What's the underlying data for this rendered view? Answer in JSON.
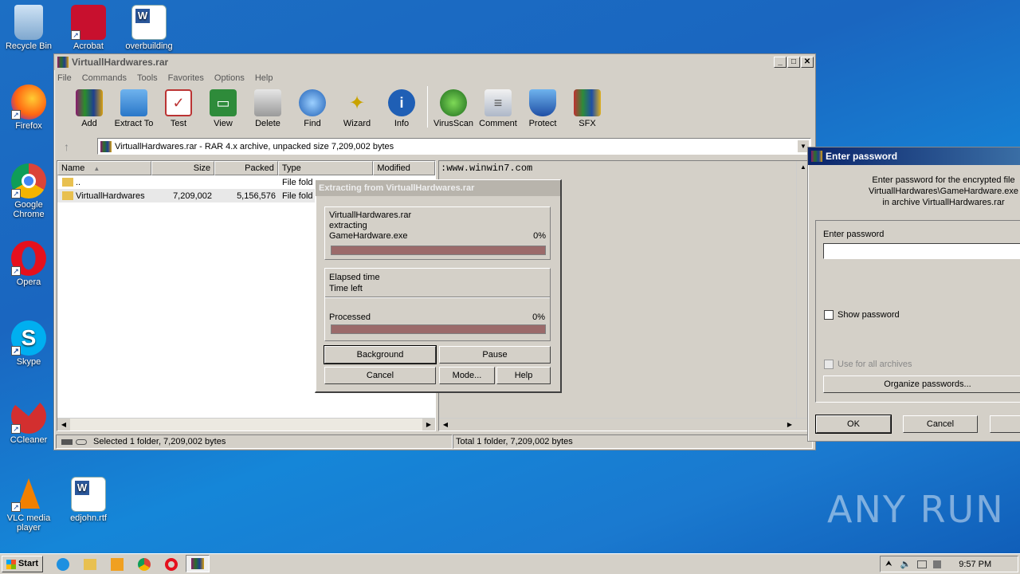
{
  "desktop": {
    "icons": [
      {
        "label": "Recycle Bin"
      },
      {
        "label": "Acrobat"
      },
      {
        "label": "overbuilding"
      },
      {
        "label": "Firefox"
      },
      {
        "label": "Google Chrome"
      },
      {
        "label": "Opera"
      },
      {
        "label": "Skype"
      },
      {
        "label": "CCleaner"
      },
      {
        "label": "VLC media player"
      },
      {
        "label": "edjohn.rtf"
      }
    ],
    "watermark": "ANY RUN"
  },
  "winrar": {
    "title": "VirtuallHardwares.rar",
    "menu": [
      "File",
      "Commands",
      "Tools",
      "Favorites",
      "Options",
      "Help"
    ],
    "toolbar": [
      "Add",
      "Extract To",
      "Test",
      "View",
      "Delete",
      "Find",
      "Wizard",
      "Info",
      "VirusScan",
      "Comment",
      "Protect",
      "SFX"
    ],
    "address": "VirtuallHardwares.rar - RAR 4.x archive, unpacked size 7,209,002 bytes",
    "columns": {
      "name": "Name",
      "size": "Size",
      "packed": "Packed",
      "type": "Type",
      "modified": "Modified"
    },
    "rows": [
      {
        "name": "..",
        "size": "",
        "packed": "",
        "type": "File fold"
      },
      {
        "name": "VirtuallHardwares",
        "size": "7,209,002",
        "packed": "5,156,576",
        "type": "File fold"
      }
    ],
    "comment": ":www.winwin7.com",
    "status_left": "Selected 1 folder, 7,209,002 bytes",
    "status_right": "Total 1 folder, 7,209,002 bytes"
  },
  "extract": {
    "title": "Extracting from VirtuallHardwares.rar",
    "archive": "VirtuallHardwares.rar",
    "action": "extracting",
    "file": "GameHardware.exe",
    "file_pct": "0%",
    "file_progress": 0,
    "elapsed_label": "Elapsed time",
    "left_label": "Time left",
    "processed_label": "Processed",
    "processed_pct": "0%",
    "processed_progress": 0,
    "buttons": {
      "background": "Background",
      "pause": "Pause",
      "cancel": "Cancel",
      "mode": "Mode...",
      "help": "Help"
    }
  },
  "password": {
    "title": "Enter password",
    "msg1": "Enter password for the encrypted file",
    "msg2": "VirtuallHardwares\\GameHardware.exe",
    "msg3": "in archive VirtuallHardwares.rar",
    "field_label": "Enter password",
    "value": "",
    "show_label": "Show password",
    "all_label": "Use for all archives",
    "organize": "Organize passwords...",
    "ok": "OK",
    "cancel": "Cancel"
  },
  "taskbar": {
    "start": "Start",
    "time": "9:57 PM"
  },
  "colors": {
    "titlebar_active": "#0a246a",
    "progress_fill": "#9b6a6a",
    "desktop": "#1a66c0"
  }
}
